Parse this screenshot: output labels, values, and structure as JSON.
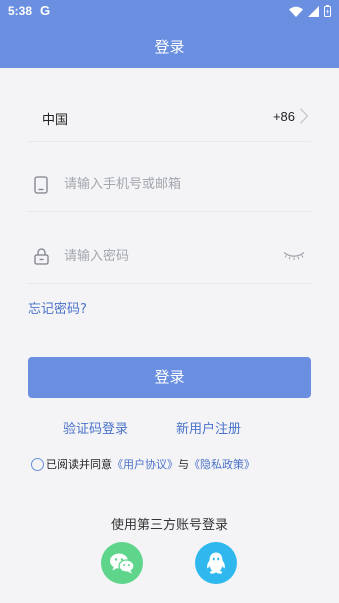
{
  "status_bar": {
    "time": "5:38",
    "g_icon": "G",
    "icons": [
      "wifi-icon",
      "signal-icon",
      "battery-icon"
    ]
  },
  "header": {
    "title": "登录"
  },
  "country": {
    "label": "中国",
    "code": "+86"
  },
  "phone": {
    "placeholder": "请输入手机号或邮箱",
    "value": ""
  },
  "password": {
    "placeholder": "请输入密码",
    "value": ""
  },
  "forgot": "忘记密码?",
  "login_button": "登录",
  "links": {
    "sms_login": "验证码登录",
    "register": "新用户注册"
  },
  "agreement": {
    "prefix": "已阅读并同意",
    "user_agreement": "《用户协议》",
    "and": "与",
    "privacy_policy": "《隐私政策》",
    "checked": false
  },
  "third_party": {
    "title": "使用第三方账号登录",
    "providers": [
      "wechat-icon",
      "qq-icon"
    ]
  },
  "colors": {
    "primary": "#6a8fe0",
    "link": "#4a72c8",
    "wechat": "#5fd58b",
    "qq": "#2fb8ee",
    "background": "#f4f4f7"
  }
}
